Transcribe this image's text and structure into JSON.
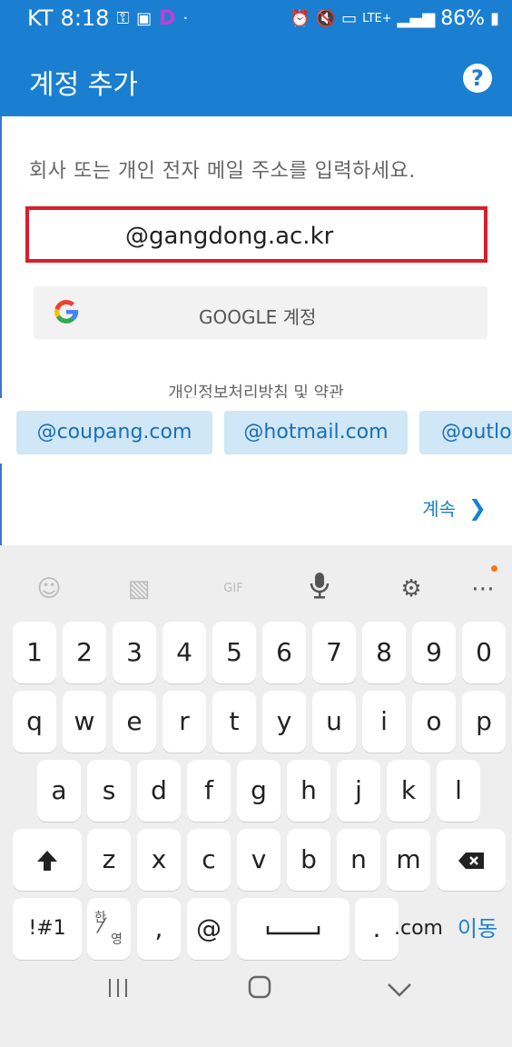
{
  "status_bar": {
    "carrier": "KT",
    "time": "8:18",
    "right_text": "86%",
    "signal_label": "LTE+"
  },
  "app_bar": {
    "title": "계정 추가",
    "help": "?"
  },
  "main": {
    "prompt": "회사 또는 개인 전자 메일 주소를 입력하세요.",
    "email_value": "@gangdong.ac.kr",
    "google_button": "GOOGLE 계정",
    "privacy_link": "개인정보처리방침 및 약관",
    "suggestions": [
      "@coupang.com",
      "@hotmail.com",
      "@outlo"
    ],
    "continue_label": "계속"
  },
  "keyboard": {
    "numbers": [
      "1",
      "2",
      "3",
      "4",
      "5",
      "6",
      "7",
      "8",
      "9",
      "0"
    ],
    "row1": [
      "q",
      "w",
      "e",
      "r",
      "t",
      "y",
      "u",
      "i",
      "o",
      "p"
    ],
    "row2": [
      "a",
      "s",
      "d",
      "f",
      "g",
      "h",
      "j",
      "k",
      "l"
    ],
    "row3": [
      "z",
      "x",
      "c",
      "v",
      "b",
      "n",
      "m"
    ],
    "symbols_key": "!#1",
    "lang_key_top": "한",
    "lang_key_bottom": "영",
    "comma": ",",
    "at": "@",
    "period": ".",
    "com_key": ".com",
    "go_key": "이동",
    "tool_gif": "GIF"
  },
  "colors": {
    "accent": "#1a7fd1",
    "highlight_border": "#d91e2a",
    "chip_bg": "#cfe7f6"
  }
}
